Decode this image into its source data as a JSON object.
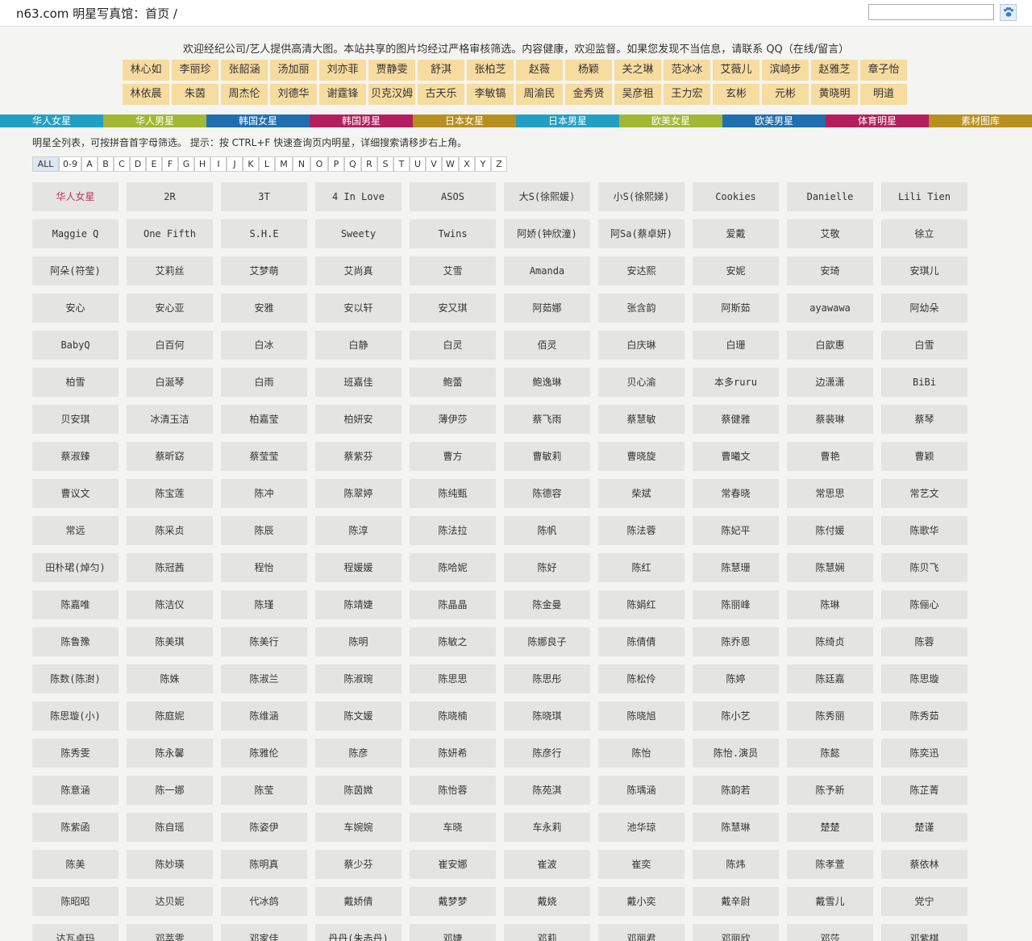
{
  "header": {
    "site_title": "n63.com 明星写真馆：首页 /",
    "search_value": "",
    "search_icon": "paw-icon"
  },
  "notice": "欢迎经纪公司/艺人提供高清大图。本站共享的图片均经过严格审核筛选。内容健康，欢迎监督。如果您发现不当信息，请联系 QQ（在线/留言）",
  "quick_links_row1": [
    "林心如",
    "李丽珍",
    "张韶涵",
    "汤加丽",
    "刘亦菲",
    "贾静雯",
    "舒淇",
    "张柏芝",
    "赵薇",
    "杨颖",
    "关之琳",
    "范冰冰",
    "艾薇儿",
    "滨崎步",
    "赵雅芝",
    "章子怡"
  ],
  "quick_links_row2": [
    "林依晨",
    "朱茵",
    "周杰伦",
    "刘德华",
    "谢霆锋",
    "贝克汉姆",
    "古天乐",
    "李敏镐",
    "周渝民",
    "金秀贤",
    "吴彦祖",
    "王力宏",
    "玄彬",
    "元彬",
    "黄晓明",
    "明道"
  ],
  "categories": [
    {
      "label": "华人女星",
      "color": "#22a0c4"
    },
    {
      "label": "华人男星",
      "color": "#a3b832"
    },
    {
      "label": "韩国女星",
      "color": "#1f6fb0"
    },
    {
      "label": "韩国男星",
      "color": "#b31f5e"
    },
    {
      "label": "日本女星",
      "color": "#b8901f"
    },
    {
      "label": "日本男星",
      "color": "#22a0c4"
    },
    {
      "label": "欧美女星",
      "color": "#a3b832"
    },
    {
      "label": "欧美男星",
      "color": "#1f6fb0"
    },
    {
      "label": "体育明星",
      "color": "#b31f5e"
    },
    {
      "label": "素材图库",
      "color": "#b8901f"
    }
  ],
  "tip": "明星全列表，可按拼音首字母筛选。 提示：按 CTRL+F 快速查询页内明星，详细搜索请移步右上角。",
  "alphabet": [
    "ALL",
    "0-9",
    "A",
    "B",
    "C",
    "D",
    "E",
    "F",
    "G",
    "H",
    "I",
    "J",
    "K",
    "L",
    "M",
    "N",
    "O",
    "P",
    "Q",
    "R",
    "S",
    "T",
    "U",
    "V",
    "W",
    "X",
    "Y",
    "Z"
  ],
  "stars": [
    "华人女星",
    "2R",
    "3T",
    "4 In Love",
    "ASOS",
    "大S(徐熙媛)",
    "小S(徐熙娣)",
    "Cookies",
    "Danielle",
    "Lili Tien",
    "Maggie Q",
    "One Fifth",
    "S.H.E",
    "Sweety",
    "Twins",
    "阿娇(钟欣潼)",
    "阿Sa(蔡卓妍)",
    "爱戴",
    "艾敬",
    "徐立",
    "阿朵(符莹)",
    "艾莉丝",
    "艾梦萌",
    "艾尚真",
    "艾雪",
    "Amanda",
    "安达熙",
    "安妮",
    "安琦",
    "安琪儿",
    "安心",
    "安心亚",
    "安雅",
    "安以轩",
    "安又琪",
    "阿茹娜",
    "张含韵",
    "阿斯茹",
    "ayawawa",
    "阿幼朵",
    "BabyQ",
    "白百何",
    "白冰",
    "白静",
    "白灵",
    "佰灵",
    "白庆琳",
    "白珊",
    "白歆惠",
    "白雪",
    "柏雪",
    "白涎琴",
    "白雨",
    "班嘉佳",
    "鲍蕾",
    "鲍逸琳",
    "贝心渝",
    "本多ruru",
    "边潇潇",
    "BiBi",
    "贝安琪",
    "冰清玉洁",
    "柏嘉莹",
    "柏妍安",
    "薄伊莎",
    "蔡飞雨",
    "蔡慧敏",
    "蔡健雅",
    "蔡裴琳",
    "蔡琴",
    "蔡淑臻",
    "蔡昕窈",
    "蔡莹莹",
    "蔡紫芬",
    "曹方",
    "曹敏莉",
    "曹晓旋",
    "曹曦文",
    "曹艳",
    "曹颖",
    "曹议文",
    "陈宝莲",
    "陈冲",
    "陈翠婷",
    "陈纯甄",
    "陈德容",
    "柴斌",
    "常春晓",
    "常思思",
    "常艺文",
    "常远",
    "陈采贞",
    "陈辰",
    "陈淳",
    "陈法拉",
    "陈帆",
    "陈法蓉",
    "陈妃平",
    "陈付媛",
    "陈歌华",
    "田朴珺(焯匀)",
    "陈冠茜",
    "程怡",
    "程媛媛",
    "陈哈妮",
    "陈好",
    "陈红",
    "陈慧珊",
    "陈慧娴",
    "陈贝飞",
    "陈嘉唯",
    "陈洁仪",
    "陈瑾",
    "陈靖婕",
    "陈晶晶",
    "陈金曼",
    "陈娟红",
    "陈丽峰",
    "陈琳",
    "陈俪心",
    "陈鲁豫",
    "陈美琪",
    "陈美行",
    "陈明",
    "陈敏之",
    "陈娜良子",
    "陈倩倩",
    "陈乔恩",
    "陈绮贞",
    "陈蓉",
    "陈数(陈澍)",
    "陈姝",
    "陈淑兰",
    "陈淑琬",
    "陈思思",
    "陈思彤",
    "陈松伶",
    "陈婷",
    "陈廷嘉",
    "陈思璇",
    "陈思璇(小)",
    "陈庭妮",
    "陈维涵",
    "陈文媛",
    "陈晓楠",
    "陈晓琪",
    "陈晓旭",
    "陈小艺",
    "陈秀丽",
    "陈秀茹",
    "陈秀雯",
    "陈永馨",
    "陈雅伦",
    "陈彦",
    "陈妍希",
    "陈彦行",
    "陈怡",
    "陈怡.演员",
    "陈懿",
    "陈奕迅",
    "陈意涵",
    "陈一娜",
    "陈莹",
    "陈茵媺",
    "陈怡蓉",
    "陈苑淇",
    "陈瑀涵",
    "陈韵若",
    "陈予新",
    "陈芷菁",
    "陈紫函",
    "陈自瑶",
    "陈姿伊",
    "车婉婉",
    "车晓",
    "车永莉",
    "池华琼",
    "陈慧琳",
    "楚楚",
    "楚谨",
    "陈美",
    "陈妙瑛",
    "陈明真",
    "蔡少芬",
    "崔安娜",
    "崔波",
    "崔奕",
    "陈炜",
    "陈孝萱",
    "蔡依林",
    "陈昭昭",
    "达贝妮",
    "代冰鸽",
    "戴娇倩",
    "戴梦梦",
    "戴娆",
    "戴小奕",
    "戴辛尉",
    "戴雪儿",
    "党宁",
    "达瓦卓玛",
    "邓萃雯",
    "邓家佳",
    "丹丹(朱赤丹)",
    "邓婕",
    "邓莉",
    "邓丽君",
    "邓丽欣",
    "邓莎",
    "邓紫棋"
  ]
}
